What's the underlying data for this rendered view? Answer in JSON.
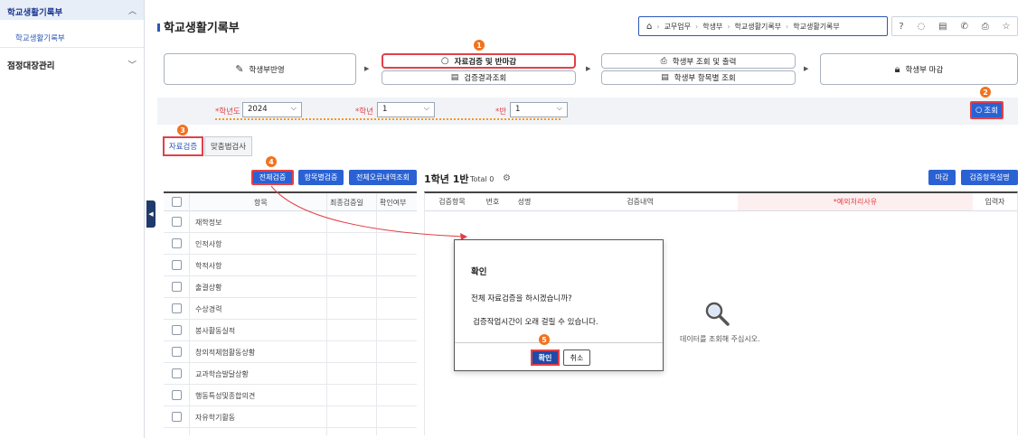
{
  "sidebar": {
    "menu1": "학교생활기록부",
    "menu1_sub": "학교생활기록부",
    "menu2": "점정대장관리"
  },
  "page": {
    "title": "학교생활기록부"
  },
  "breadcrumb": [
    "교무업무",
    "학생부",
    "학교생활기록부",
    "학교생활기록부"
  ],
  "workflow": {
    "reflect": "학생부반영",
    "verify": "자료검증 및 반마감",
    "verify_result": "검증결과조회",
    "print": "학생부 조회 및 출력",
    "item_view": "학생부 항목별 조회",
    "close": "학생부 마감"
  },
  "filters": {
    "year_label": "*학년도",
    "year_value": "2024",
    "grade_label": "*학년",
    "grade_value": "1",
    "class_label": "*반",
    "class_value": "1",
    "search": "조회"
  },
  "tabs": {
    "verify": "자료검증",
    "spell": "맞춤법검사"
  },
  "buttons": {
    "all_verify": "전체검증",
    "item_verify": "항목별검증",
    "all_error": "전체오류내역조회",
    "close": "마감",
    "verify_desc": "검증항목설명"
  },
  "left_table": {
    "headers": [
      "항목",
      "최종검증일",
      "확인여부"
    ],
    "rows": [
      "재학정보",
      "인적사항",
      "학적사항",
      "출결상황",
      "수상경력",
      "봉사활동실적",
      "창의적체험활동상황",
      "교과학습발달상황",
      "행동특성및종합의견",
      "자유학기활동"
    ]
  },
  "right_panel": {
    "title": "1학년 1반",
    "total": "Total 0",
    "headers": [
      "검증항목",
      "번호",
      "성명",
      "검증내역",
      "*예외처리사유",
      "입력자"
    ],
    "empty": "데이터를 조회해 주십시오."
  },
  "dialog": {
    "title": "확인",
    "message1": "전체 자료검증을 하시겠습니까?",
    "message2": "검증작업시간이 오래 걸릴 수 있습니다.",
    "ok": "확인",
    "cancel": "취소"
  },
  "steps": [
    "1",
    "2",
    "3",
    "4",
    "5"
  ],
  "colors": {
    "accent": "#2b62d3",
    "highlight": "#e24047",
    "badge": "#f0731e",
    "dots": "#f3991f"
  }
}
